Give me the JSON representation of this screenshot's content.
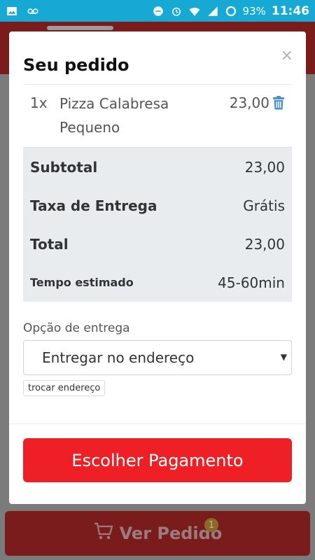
{
  "status_bar": {
    "battery_percent": "93%",
    "time": "11:46"
  },
  "modal": {
    "title": "Seu pedido",
    "close_symbol": "×",
    "item": {
      "qty": "1x",
      "name_line1": "Pizza Calabresa",
      "name_line2": "Pequeno",
      "price": "23,00"
    },
    "summary": {
      "subtotal_label": "Subtotal",
      "subtotal_value": "23,00",
      "delivery_fee_label": "Taxa de Entrega",
      "delivery_fee_value": "Grátis",
      "total_label": "Total",
      "total_value": "23,00",
      "time_label": "Tempo estimado",
      "time_value": "45-60min"
    },
    "delivery": {
      "label": "Opção de entrega",
      "selected": "Entregar no endereço",
      "change_address": "trocar endereço"
    },
    "pay_button": "Escolher Pagamento"
  },
  "bottom_bar": {
    "label": "Ver Pedido",
    "badge": "1"
  }
}
